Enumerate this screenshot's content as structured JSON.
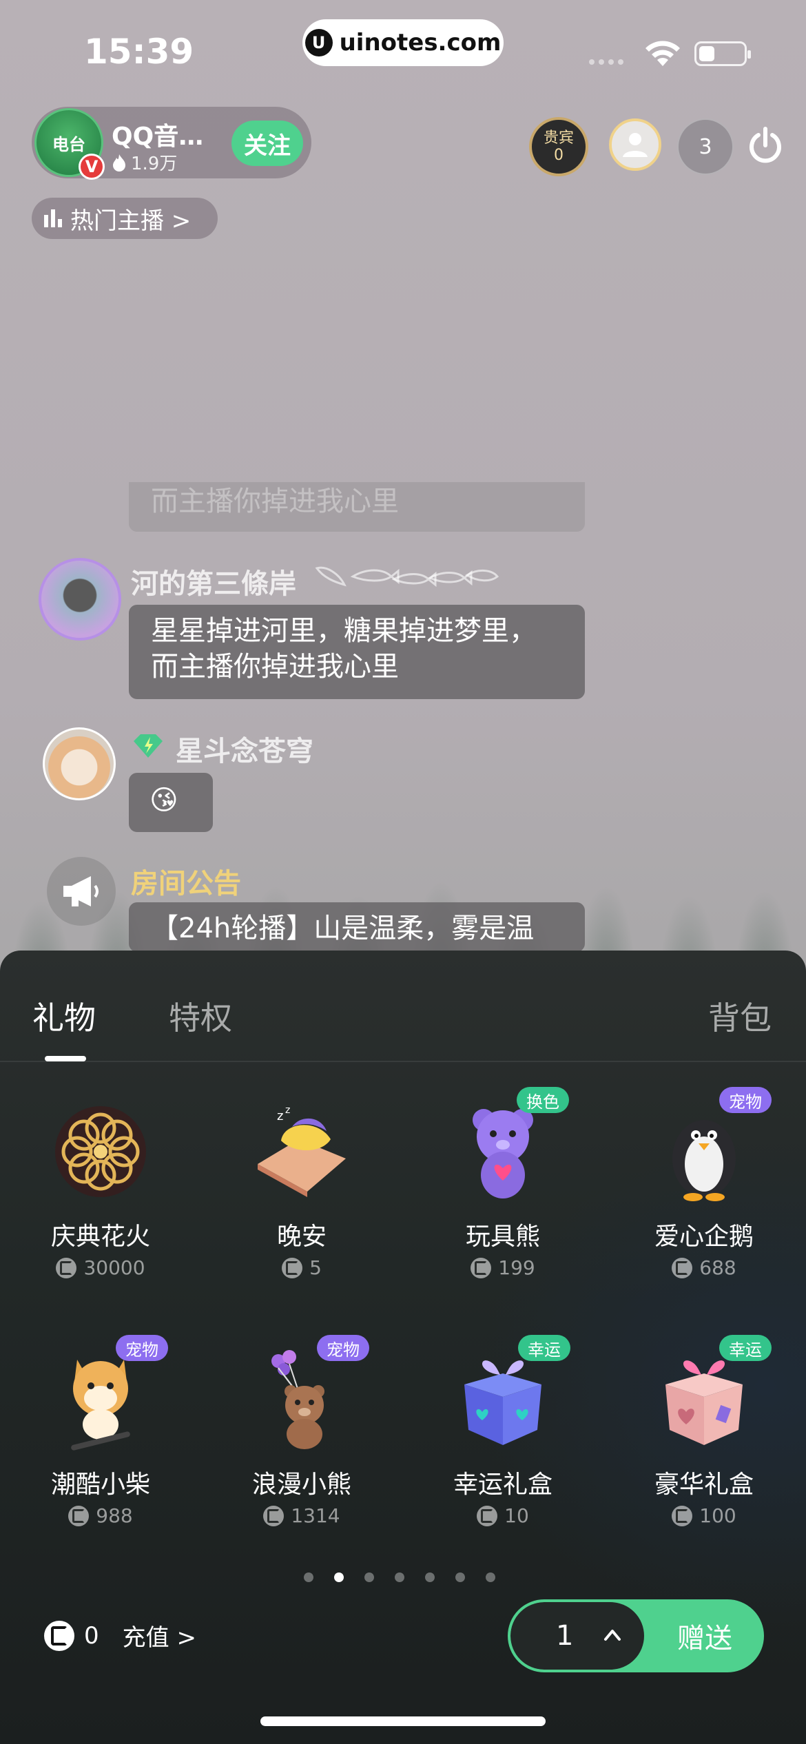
{
  "status_bar": {
    "time": "15:39",
    "url": "uinotes.com",
    "battery_level": 0.3
  },
  "host": {
    "name": "QQ音…",
    "fans": "1.9万",
    "follow_label": "关注",
    "avatar_text": "电台"
  },
  "top_right": {
    "guest_label": "贵宾",
    "guest_count": "0",
    "viewer_count": "3"
  },
  "hot_hosts_label": "热门主播 >",
  "chat": {
    "ghost_text": "而主播你掉进我心里",
    "messages": [
      {
        "user": "河的第三條岸",
        "text_lines": [
          "星星掉进河里，糖果掉进梦里，",
          "而主播你掉进我心里"
        ]
      },
      {
        "user": "星斗念苍穹",
        "emoji": "😘"
      },
      {
        "user": "房间公告",
        "text_lines": [
          "【24h轮播】山是温柔，雾是温"
        ]
      }
    ]
  },
  "gift_panel": {
    "tabs": [
      "礼物",
      "特权"
    ],
    "bag_label": "背包",
    "gifts": [
      {
        "name": "庆典花火",
        "price": "30000",
        "tag": ""
      },
      {
        "name": "晚安",
        "price": "5",
        "tag": ""
      },
      {
        "name": "玩具熊",
        "price": "199",
        "tag": "换色"
      },
      {
        "name": "爱心企鹅",
        "price": "688",
        "tag": "宠物"
      },
      {
        "name": "潮酷小柴",
        "price": "988",
        "tag": "宠物"
      },
      {
        "name": "浪漫小熊",
        "price": "1314",
        "tag": "宠物"
      },
      {
        "name": "幸运礼盒",
        "price": "10",
        "tag": "幸运"
      },
      {
        "name": "豪华礼盒",
        "price": "100",
        "tag": "幸运"
      }
    ],
    "page_count": 7,
    "active_page": 2,
    "balance": "0",
    "recharge_label": "充值 >",
    "quantity": "1",
    "send_label": "赠送"
  },
  "colors": {
    "accent_green": "#4fd18e",
    "pet_tag": "#8d6ef0",
    "lucky_tag": "#33c48b"
  }
}
